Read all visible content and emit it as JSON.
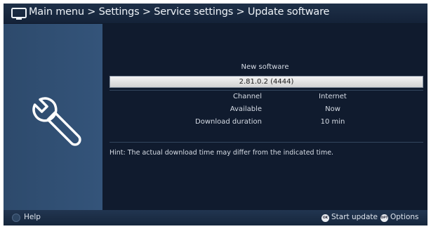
{
  "header": {
    "breadcrumb": "Main menu > Settings > Service settings > Update software",
    "icon": "tv-icon"
  },
  "side_panel": {
    "icon": "wrench-icon"
  },
  "main": {
    "title": "New software",
    "version": "2.81.0.2 (4444)",
    "details": [
      {
        "label": "Channel",
        "value": "Internet"
      },
      {
        "label": "Available",
        "value": "Now"
      },
      {
        "label": "Download duration",
        "value": "10 min"
      }
    ],
    "hint": "Hint: The actual download time may differ from the indicated time."
  },
  "footer": {
    "help_label": "Help",
    "ok_key": "OK",
    "start_update_label": "Start update",
    "opt_key": "OPT",
    "options_label": "Options"
  },
  "colors": {
    "background": "#101b2e",
    "side_panel": "#2f4e72",
    "highlight_bar": "#e6e6e6",
    "text": "#d7dde6"
  }
}
